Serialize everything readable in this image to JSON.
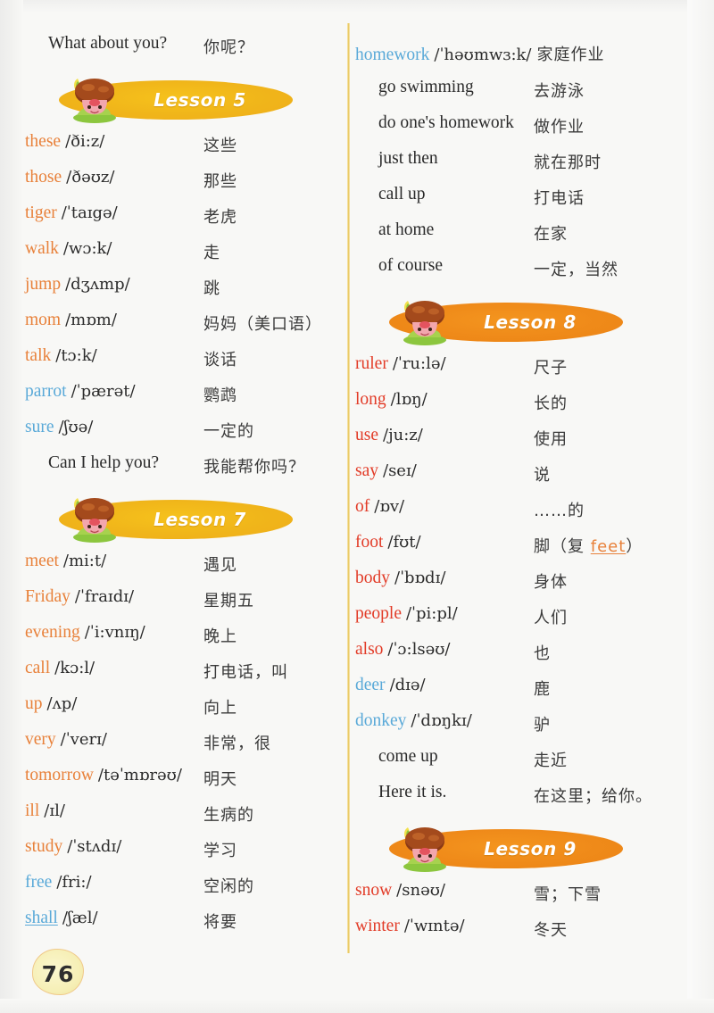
{
  "page": {
    "number": "76",
    "book_type": "english-chinese-vocabulary-list"
  },
  "colors": {
    "paper": "#f8f8f6",
    "orange_word": "#e8813a",
    "red_word": "#e23b27",
    "blue_word": "#59a9d8",
    "banner_gold": "#f0b51a",
    "banner_orange": "#ef8a19",
    "divider": "#e9c964",
    "chinese_text": "#3a3a3a"
  },
  "left_column": {
    "intro_phrase": {
      "en": "What about you?",
      "cn": "你呢？"
    },
    "lesson5": {
      "banner_label": "Lesson 5",
      "banner_style": "gold",
      "entries": [
        {
          "word": "these",
          "color": "orange",
          "ipa": "/ði:z/",
          "cn": "这些"
        },
        {
          "word": "those",
          "color": "orange",
          "ipa": "/ðəʊz/",
          "cn": "那些"
        },
        {
          "word": "tiger",
          "color": "orange",
          "ipa": "/ˈtaɪgə/",
          "cn": "老虎"
        },
        {
          "word": "walk",
          "color": "orange",
          "ipa": "/wɔ:k/",
          "cn": "走"
        },
        {
          "word": "jump",
          "color": "orange",
          "ipa": "/dʒʌmp/",
          "cn": "跳"
        },
        {
          "word": "mom",
          "color": "orange",
          "ipa": "/mɒm/",
          "cn": "妈妈（美口语）"
        },
        {
          "word": "talk",
          "color": "orange",
          "ipa": "/tɔ:k/",
          "cn": "谈话"
        },
        {
          "word": "parrot",
          "color": "blue",
          "ipa": "/ˈpærət/",
          "cn": "鹦鹉"
        },
        {
          "word": "sure",
          "color": "blue",
          "ipa": "/ʃʊə/",
          "cn": "一定的"
        },
        {
          "phrase": "Can I help you?",
          "cn": "我能帮你吗？",
          "indent": true
        }
      ]
    },
    "lesson7": {
      "banner_label": "Lesson 7",
      "banner_style": "gold",
      "entries": [
        {
          "word": "meet",
          "color": "orange",
          "ipa": "/mi:t/",
          "cn": "遇见"
        },
        {
          "word": "Friday",
          "color": "orange",
          "ipa": "/ˈfraɪdɪ/",
          "cn": "星期五"
        },
        {
          "word": "evening",
          "color": "orange",
          "ipa": "/ˈi:vnɪŋ/",
          "cn": "晚上"
        },
        {
          "word": "call",
          "color": "orange",
          "ipa": "/kɔ:l/",
          "cn": "打电话，叫"
        },
        {
          "word": "up",
          "color": "orange",
          "ipa": "/ʌp/",
          "cn": "向上"
        },
        {
          "word": "very",
          "color": "orange",
          "ipa": "/ˈverɪ/",
          "cn": "非常，很"
        },
        {
          "word": "tomorrow",
          "color": "orange",
          "ipa": "/təˈmɒrəʊ/",
          "cn": "明天"
        },
        {
          "word": "ill",
          "color": "orange",
          "ipa": "/ɪl/",
          "cn": "生病的"
        },
        {
          "word": "study",
          "color": "orange",
          "ipa": "/ˈstʌdɪ/",
          "cn": "学习"
        },
        {
          "word": "free",
          "color": "blue",
          "ipa": "/fri:/",
          "cn": "空闲的"
        },
        {
          "word": "shall",
          "color": "blue",
          "underline": true,
          "ipa": "/ʃæl/",
          "cn": "将要"
        }
      ]
    }
  },
  "right_column": {
    "lesson7_continued": {
      "entries": [
        {
          "word": "homework",
          "color": "blue",
          "ipa": "/ˈhəʊmwɜ:k/",
          "cn": "家庭作业",
          "inline_cn": true
        },
        {
          "phrase": "go swimming",
          "cn": "去游泳",
          "indent": true
        },
        {
          "phrase": "do one's homework",
          "cn": "做作业",
          "indent": true
        },
        {
          "phrase": "just then",
          "cn": "就在那时",
          "indent": true
        },
        {
          "phrase": "call up",
          "cn": "打电话",
          "indent": true
        },
        {
          "phrase": "at home",
          "cn": "在家",
          "indent": true
        },
        {
          "phrase": "of course",
          "cn": "一定，当然",
          "indent": true
        }
      ]
    },
    "lesson8": {
      "banner_label": "Lesson 8",
      "banner_style": "orange",
      "entries": [
        {
          "word": "ruler",
          "color": "red",
          "ipa": "/ˈru:lə/",
          "cn": "尺子"
        },
        {
          "word": "long",
          "color": "red",
          "ipa": "/lɒŋ/",
          "cn": "长的"
        },
        {
          "word": "use",
          "color": "red",
          "ipa": "/ju:z/",
          "cn": "使用"
        },
        {
          "word": "say",
          "color": "red",
          "ipa": "/seɪ/",
          "cn": "说"
        },
        {
          "word": "of",
          "color": "red",
          "ipa": "/ɒv/",
          "cn": "……的"
        },
        {
          "word": "foot",
          "color": "red",
          "ipa": "/fʊt/",
          "cn_prefix": "脚（复 ",
          "cn_highlight": "feet",
          "cn_suffix": "）"
        },
        {
          "word": "body",
          "color": "red",
          "ipa": "/ˈbɒdɪ/",
          "cn": "身体"
        },
        {
          "word": "people",
          "color": "red",
          "ipa": "/ˈpi:pl/",
          "cn": "人们"
        },
        {
          "word": "also",
          "color": "red",
          "ipa": "/ˈɔ:lsəʊ/",
          "cn": "也"
        },
        {
          "word": "deer",
          "color": "blue",
          "ipa": "/dɪə/",
          "cn": "鹿"
        },
        {
          "word": "donkey",
          "color": "blue",
          "ipa": "/ˈdɒŋkɪ/",
          "cn": "驴"
        },
        {
          "phrase": "come up",
          "cn": "走近",
          "indent": true
        },
        {
          "phrase": "Here it is.",
          "cn": "在这里；给你。",
          "indent": true
        }
      ]
    },
    "lesson9": {
      "banner_label": "Lesson 9",
      "banner_style": "orange",
      "entries": [
        {
          "word": "snow",
          "color": "red",
          "ipa": "/snəʊ/",
          "cn": "雪；下雪"
        },
        {
          "word": "winter",
          "color": "red",
          "ipa": "/ˈwɪntə/",
          "cn": "冬天"
        }
      ]
    }
  }
}
